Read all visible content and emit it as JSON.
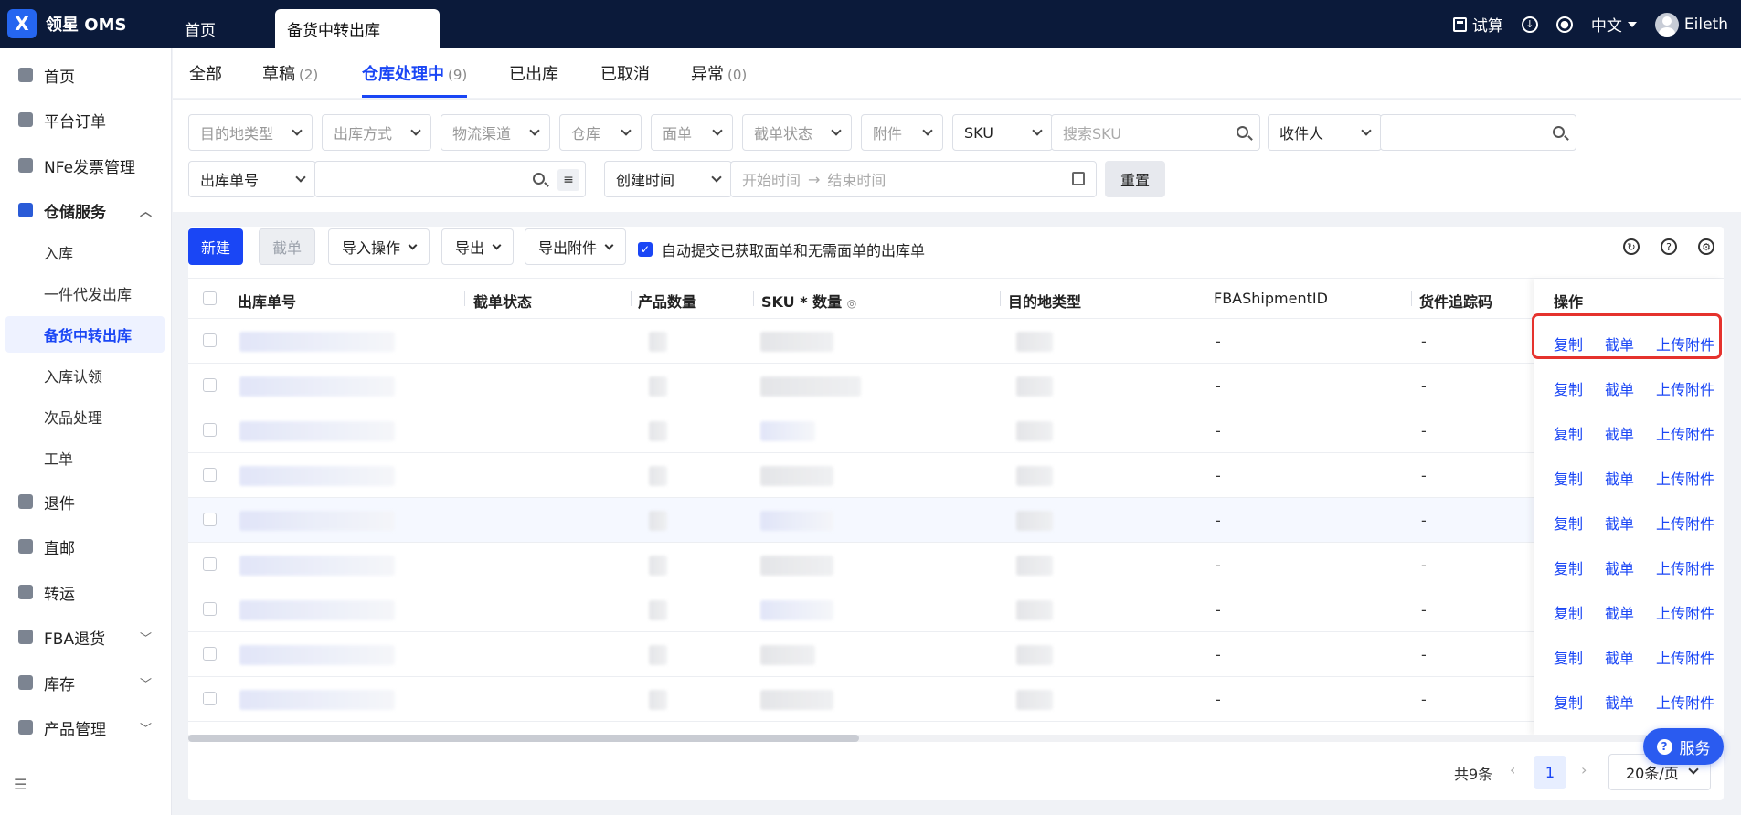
{
  "app": {
    "logo_text": "领星 OMS"
  },
  "top_tabs": [
    {
      "label": "首页"
    },
    {
      "label": "备货中转出库"
    }
  ],
  "top_right": {
    "calc_label": "试算",
    "lang_label": "中文",
    "user_name": "Eileth"
  },
  "sidebar": {
    "items": [
      {
        "label": "首页"
      },
      {
        "label": "平台订单"
      },
      {
        "label": "NFe发票管理"
      },
      {
        "label": "仓储服务"
      },
      {
        "label": "入库"
      },
      {
        "label": "一件代发出库"
      },
      {
        "label": "备货中转出库"
      },
      {
        "label": "入库认领"
      },
      {
        "label": "次品处理"
      },
      {
        "label": "工单"
      },
      {
        "label": "退件"
      },
      {
        "label": "直邮"
      },
      {
        "label": "转运"
      },
      {
        "label": "FBA退货"
      },
      {
        "label": "库存"
      },
      {
        "label": "产品管理"
      }
    ]
  },
  "status_tabs": [
    {
      "label": "全部",
      "count": ""
    },
    {
      "label": "草稿",
      "count": "(2)"
    },
    {
      "label": "仓库处理中",
      "count": "(9)"
    },
    {
      "label": "已出库",
      "count": ""
    },
    {
      "label": "已取消",
      "count": ""
    },
    {
      "label": "异常",
      "count": "(0)"
    }
  ],
  "filters": {
    "dest_type": "目的地类型",
    "out_method": "出库方式",
    "channel": "物流渠道",
    "warehouse": "仓库",
    "label": "面单",
    "intercept": "截单状态",
    "attachment": "附件",
    "sku_select": "SKU",
    "sku_placeholder": "搜索SKU",
    "receiver_select": "收件人",
    "order_no_select": "出库单号",
    "time_select": "创建时间",
    "start_time": "开始时间",
    "end_time": "结束时间",
    "reset": "重置"
  },
  "toolbar": {
    "new": "新建",
    "intercept": "截单",
    "import": "导入操作",
    "export": "导出",
    "export_attach": "导出附件",
    "auto_submit": "自动提交已获取面单和无需面单的出库单"
  },
  "table": {
    "headers": {
      "order_no": "出库单号",
      "intercept_status": "截单状态",
      "qty": "产品数量",
      "sku_qty": "SKU * 数量",
      "dest_type": "目的地类型",
      "fba_id": "FBAShipmentID",
      "tracking": "货件追踪码",
      "ops": "操作"
    },
    "rows": [
      {
        "fba_id": "-",
        "tracking": "-",
        "op_copy": "复制",
        "op_intercept": "截单",
        "op_upload": "上传附件"
      },
      {
        "fba_id": "-",
        "tracking": "-",
        "op_copy": "复制",
        "op_intercept": "截单",
        "op_upload": "上传附件"
      },
      {
        "fba_id": "-",
        "tracking": "-",
        "op_copy": "复制",
        "op_intercept": "截单",
        "op_upload": "上传附件"
      },
      {
        "fba_id": "-",
        "tracking": "-",
        "op_copy": "复制",
        "op_intercept": "截单",
        "op_upload": "上传附件"
      },
      {
        "fba_id": "-",
        "tracking": "-",
        "op_copy": "复制",
        "op_intercept": "截单",
        "op_upload": "上传附件"
      },
      {
        "fba_id": "-",
        "tracking": "-",
        "op_copy": "复制",
        "op_intercept": "截单",
        "op_upload": "上传附件"
      },
      {
        "fba_id": "-",
        "tracking": "-",
        "op_copy": "复制",
        "op_intercept": "截单",
        "op_upload": "上传附件"
      },
      {
        "fba_id": "-",
        "tracking": "-",
        "op_copy": "复制",
        "op_intercept": "截单",
        "op_upload": "上传附件"
      },
      {
        "fba_id": "-",
        "tracking": "-",
        "op_copy": "复制",
        "op_intercept": "截单",
        "op_upload": "上传附件"
      }
    ]
  },
  "pager": {
    "total": "共9条",
    "page": "1",
    "page_size": "20条/页"
  },
  "service": {
    "label": "服务"
  },
  "colors": {
    "primary": "#1a46f5",
    "topbar": "#0b1a3a",
    "highlight": "#e5322d"
  }
}
